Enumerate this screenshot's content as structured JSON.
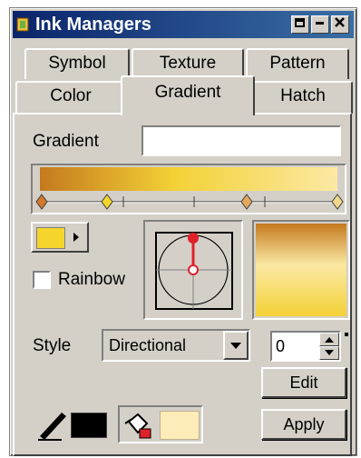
{
  "window": {
    "title": "Ink Managers",
    "buttons": [
      "restore-icon",
      "minimize-icon",
      "close-icon"
    ]
  },
  "tabs": {
    "row_back": [
      "Symbol",
      "Texture",
      "Pattern"
    ],
    "row_front": [
      "Color",
      "Gradient",
      "Hatch"
    ],
    "active": "Gradient"
  },
  "gradient": {
    "name_label": "Gradient",
    "name_value": "",
    "bar_colors": [
      "#c47a1e",
      "#f3d136",
      "#fbe9a4"
    ],
    "stop_colors": [
      "#d37a2a",
      "#f5d42c",
      "#e3a85c",
      "#f1d888"
    ],
    "rainbow_label": "Rainbow",
    "rainbow_checked": false,
    "current_color": "#f5d42c"
  },
  "style": {
    "label": "Style",
    "value": "Directional",
    "angle_value": "0"
  },
  "buttons": {
    "edit": "Edit",
    "apply": "Apply"
  },
  "bottom": {
    "pen_color": "#000000",
    "fill_color": "#fdebb8"
  },
  "accent": {
    "titlebar": "#0a246a",
    "handle": "#e0202a"
  }
}
